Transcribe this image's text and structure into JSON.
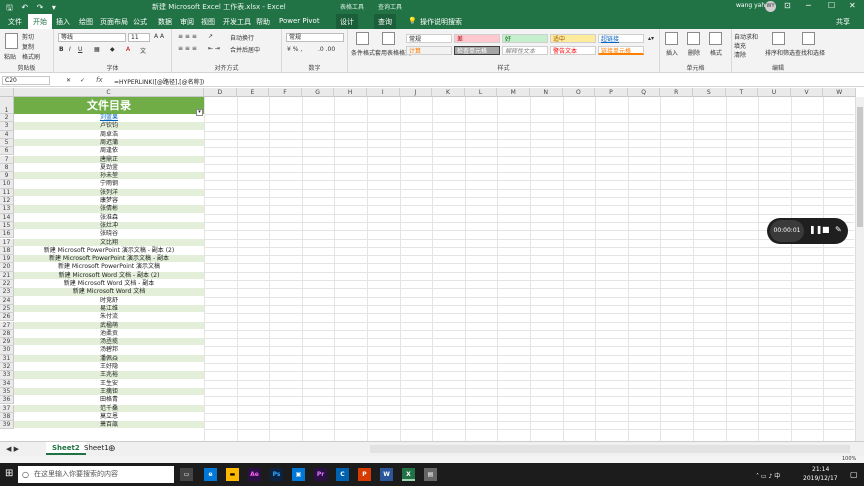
{
  "title": {
    "quick_access": "🖫 ↶ ↷ ▾",
    "document": "新建 Microsoft Excel 工作表.xlsx - Excel",
    "context_tools_1": "表格工具",
    "context_tools_2": "查询工具",
    "user": "wang yahui",
    "avatar": "WY"
  },
  "menu": {
    "items": [
      "文件",
      "开始",
      "插入",
      "绘图",
      "页面布局",
      "公式",
      "数据",
      "审阅",
      "视图",
      "开发工具",
      "帮助",
      "Power Pivot"
    ],
    "context": [
      "设计",
      "查询"
    ],
    "tell_me": "操作说明搜索",
    "share": "共享"
  },
  "ribbon": {
    "clipboard": {
      "label": "剪贴板",
      "paste": "粘贴",
      "cut": "剪切",
      "copy": "复制",
      "painter": "格式刷"
    },
    "font": {
      "label": "字体",
      "name": "等线",
      "size": "11"
    },
    "alignment": {
      "label": "对齐方式",
      "wrap": "自动换行",
      "merge": "合并后居中"
    },
    "number": {
      "label": "数字",
      "format": "常规"
    },
    "styles": {
      "label": "样式",
      "conditional": "条件格式",
      "table": "套用表格格式",
      "cells": [
        "常规",
        "差",
        "好",
        "适中",
        "超链接",
        "计算",
        "检查单元格",
        "解释性文本",
        "警告文本",
        "链接单元格"
      ]
    },
    "cells": {
      "label": "单元格",
      "insert": "插入",
      "delete": "删除",
      "format": "格式"
    },
    "editing": {
      "label": "编辑",
      "autosum": "自动求和",
      "fill": "填充",
      "clear": "清除",
      "sort": "排序和筛选",
      "find": "查找和选择"
    }
  },
  "formula_bar": {
    "name_box": "C20",
    "fx": "fx",
    "formula": "=HYPERLINK([@路径],[@名称])"
  },
  "columns": [
    "A",
    "B",
    "C",
    "D",
    "E",
    "F",
    "G",
    "H",
    "I",
    "J",
    "K",
    "L",
    "M",
    "N",
    "O",
    "P",
    "Q",
    "R",
    "S",
    "T",
    "U",
    "V",
    "W"
  ],
  "rows": [
    "1",
    "2",
    "3",
    "4",
    "5",
    "6",
    "7",
    "8",
    "9",
    "10",
    "11",
    "12",
    "13",
    "14",
    "15",
    "16",
    "17",
    "18",
    "19",
    "20",
    "21",
    "22",
    "23",
    "24",
    "25",
    "26",
    "27",
    "28",
    "29",
    "30",
    "31",
    "32",
    "33",
    "34",
    "35",
    "36",
    "37",
    "38",
    "39"
  ],
  "table": {
    "header": "文件目录",
    "items": [
      "刘蓝果",
      "卢钦钧",
      "周卓浩",
      "周迟蒲",
      "周逢依",
      "唐鼎正",
      "夏劲釜",
      "孙未堃",
      "宁雨钢",
      "张列洋",
      "康梦容",
      "张倩彬",
      "张淮森",
      "张灶冲",
      "张晓谷",
      "文比翔",
      "新建 Microsoft PowerPoint 演示文稿 - 副本 (2)",
      "新建 Microsoft PowerPoint 演示文稿 - 副本",
      "新建 Microsoft PowerPoint 演示文稿",
      "新建 Microsoft Word 文档 - 副本 (2)",
      "新建 Microsoft Word 文档 - 副本",
      "新建 Microsoft Word 文档",
      "时竞舒",
      "易江维",
      "朱付流",
      "武楹萌",
      "池柔贡",
      "汤丞揽",
      "汤碧邦",
      "潘佩焱",
      "王好隐",
      "王兆裕",
      "王生安",
      "王擒钜",
      "田格青",
      "范千桑",
      "莫立恩",
      "萧百瓿"
    ]
  },
  "sheets": [
    "Sheet2",
    "Sheet1"
  ],
  "status": {
    "zoom": "100%"
  },
  "taskbar": {
    "search": "在这里输入你要搜索的内容",
    "time": "21:14",
    "date": "2019/12/17"
  },
  "recorder": {
    "time": "00:00:01"
  }
}
